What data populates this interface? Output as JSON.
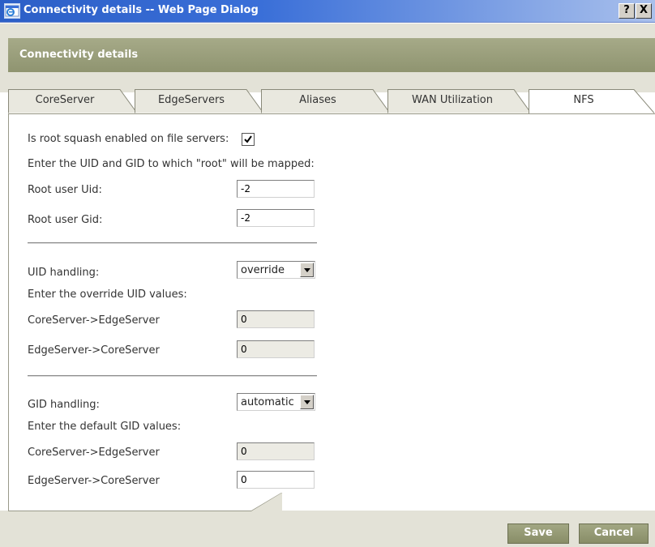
{
  "window": {
    "title": "Connectivity details -- Web Page Dialog",
    "help_label": "?",
    "close_label": "X"
  },
  "header": {
    "title": "Connectivity details"
  },
  "tabs": [
    {
      "label": "CoreServer",
      "active": false
    },
    {
      "label": "EdgeServers",
      "active": false
    },
    {
      "label": "Aliases",
      "active": false
    },
    {
      "label": "WAN Utilization",
      "active": false
    },
    {
      "label": "NFS",
      "active": true
    }
  ],
  "nfs": {
    "root_squash_label": "Is root squash enabled on file servers:",
    "root_squash_checked": true,
    "root_map_prompt": "Enter the UID and GID to which \"root\" will be mapped:",
    "root_uid_label": "Root user Uid:",
    "root_uid_value": "-2",
    "root_gid_label": "Root user Gid:",
    "root_gid_value": "-2",
    "uid_handling_label": "UID handling:",
    "uid_handling_value": "override",
    "uid_prompt": "Enter the override UID values:",
    "uid_core_to_edge_label": "CoreServer->EdgeServer",
    "uid_core_to_edge_value": "0",
    "uid_edge_to_core_label": "EdgeServer->CoreServer",
    "uid_edge_to_core_value": "0",
    "gid_handling_label": "GID handling:",
    "gid_handling_value": "automatic",
    "gid_prompt": "Enter the default GID values:",
    "gid_core_to_edge_label": "CoreServer->EdgeServer",
    "gid_core_to_edge_value": "0",
    "gid_edge_to_core_label": "EdgeServer->CoreServer",
    "gid_edge_to_core_value": "0"
  },
  "footer": {
    "save_label": "Save",
    "cancel_label": "Cancel"
  },
  "colors": {
    "titlebar": "#2c5fc7",
    "header_band": "#e3e2d7",
    "banner": "#9a9e7c",
    "button": "#969b75"
  }
}
